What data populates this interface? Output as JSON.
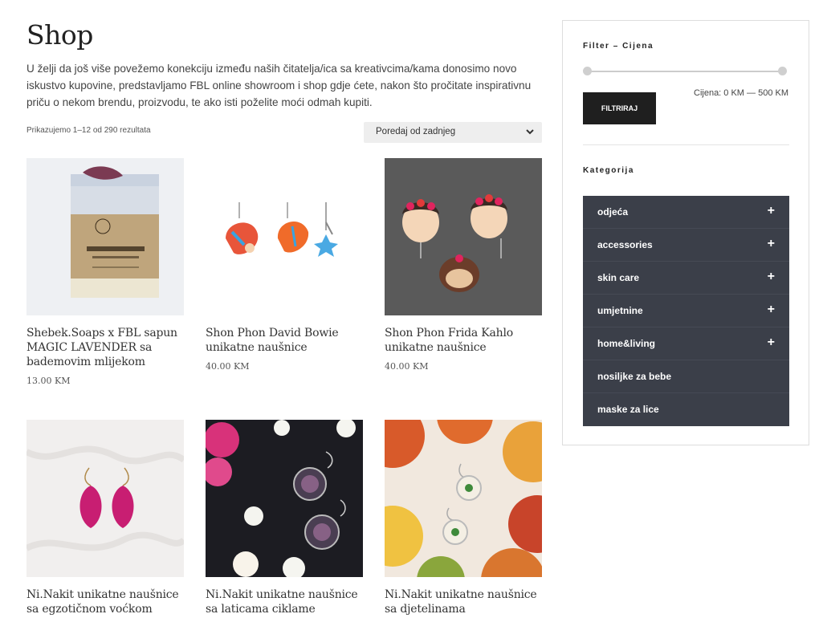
{
  "page": {
    "title": "Shop",
    "intro": "U želji da još više povežemo konekciju između naših čitatelja/ica sa kreativcima/kama donosimo novo iskustvo kupovine, predstavljamo FBL online showroom i shop gdje ćete, nakon što pročitate inspirativnu priču o nekom brendu, proizvodu, te ako isti poželite moći odmah kupiti."
  },
  "toolbar": {
    "result_count": "Prikazujemo 1–12 od 290 rezultata",
    "ordering_selected": "Poredaj od zadnjeg"
  },
  "products": [
    {
      "name": "Shebek.Soaps x FBL sapun MAGIC LAVENDER sa bademovim mlijekom",
      "price": "13.00 KM",
      "image_icon": "soap-product-image"
    },
    {
      "name": "Shon Phon David Bowie unikatne naušnice",
      "price": "40.00 KM",
      "image_icon": "bowie-earrings-image"
    },
    {
      "name": "Shon Phon Frida Kahlo unikatne naušnice",
      "price": "40.00 KM",
      "image_icon": "frida-earrings-image"
    },
    {
      "name": "Ni.Nakit unikatne naušnice sa egzotičnom voćkom",
      "price": "",
      "image_icon": "fruit-earrings-image"
    },
    {
      "name": "Ni.Nakit unikatne naušnice sa laticama ciklame",
      "price": "",
      "image_icon": "petal-earrings-image"
    },
    {
      "name": "Ni.Nakit unikatne naušnice sa djetelinama",
      "price": "",
      "image_icon": "clover-earrings-image"
    }
  ],
  "sidebar": {
    "filter_title": "Filter – Cijena",
    "filter_button": "FILTRIRAJ",
    "price_range": "Cijena: 0 KM — 500 KM",
    "category_title": "Kategorija",
    "categories": [
      {
        "label": "odjeća",
        "expandable": "+"
      },
      {
        "label": "accessories",
        "expandable": "+"
      },
      {
        "label": "skin care",
        "expandable": "+"
      },
      {
        "label": "umjetnine",
        "expandable": "+"
      },
      {
        "label": "home&living",
        "expandable": "+"
      },
      {
        "label": "nosiljke za bebe",
        "expandable": ""
      },
      {
        "label": "maske za lice",
        "expandable": ""
      }
    ]
  },
  "colors": {
    "category_bg": "#3b3f49",
    "button_bg": "#1f1f1f"
  }
}
